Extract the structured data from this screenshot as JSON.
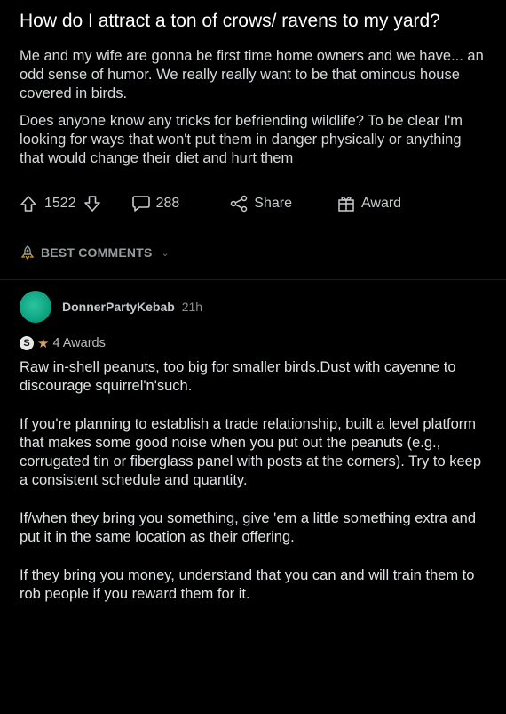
{
  "post": {
    "title": "How do I attract a ton of crows/ ravens to my yard?",
    "paragraphs": [
      "Me and my wife are gonna be first time home owners and we have... an odd sense of humor. We really really want to be that ominous house covered in birds.",
      "Does anyone know any tricks for befriending wildlife? To be clear I'm looking for ways that won't put them in danger physically or anything that would change their diet and hurt them"
    ],
    "votes": "1522",
    "comments": "288",
    "share_label": "Share",
    "award_label": "Award"
  },
  "sort": {
    "label": "BEST COMMENTS"
  },
  "comment": {
    "username": "DonnerPartyKebab",
    "age": "21h",
    "awards": "4 Awards",
    "paragraphs": [
      "Raw in-shell peanuts, too big for smaller birds.Dust with cayenne to discourage squirrel'n'such.",
      "If you're planning to establish a trade relationship, built a level platform that makes some good noise when you put out the peanuts (e.g., corrugated tin or fiberglass panel with posts at the corners).  Try to keep a consistent schedule and quantity.",
      "If/when they bring you something, give 'em a little something extra and put it in the same location as their offering.",
      "If they bring you money, understand that you can and will train them to rob people if you reward them for it."
    ],
    "avatar_color": "#14b38e"
  },
  "icons": {
    "upvote": "arrow-up-icon",
    "downvote": "arrow-down-icon",
    "comment": "speech-bubble-icon",
    "share": "share-icon",
    "award": "gift-box-icon",
    "sort": "rocket-icon"
  }
}
